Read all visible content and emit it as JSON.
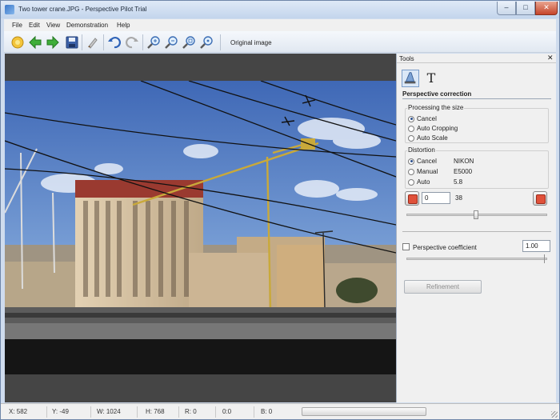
{
  "window": {
    "title": "Two tower crane.JPG - Perspective Pilot Trial",
    "minimize_glyph": "–",
    "maximize_glyph": "□",
    "close_glyph": "✕"
  },
  "menu": [
    "File",
    "Edit",
    "View",
    "Demonstration",
    "Help"
  ],
  "toolbar": {
    "icons": [
      "open-file-icon",
      "back-arrow-icon",
      "forward-arrow-icon",
      "save-icon",
      "brush-icon",
      "undo-icon",
      "redo-icon",
      "zoom-in-icon",
      "zoom-out-icon",
      "zoom-fit-icon",
      "zoom-actual-icon"
    ],
    "original_image_label": "Original image"
  },
  "tools_panel": {
    "title": "Tools",
    "close_glyph": "✕",
    "text_tab_glyph": "T",
    "section_title": "Perspective correction",
    "processing": {
      "label": "Processing the size",
      "options": [
        {
          "label": "Cancel",
          "selected": true
        },
        {
          "label": "Auto Cropping",
          "selected": false
        },
        {
          "label": "Auto Scale",
          "selected": false
        }
      ]
    },
    "distortion": {
      "label": "Distortion",
      "options": [
        {
          "label": "Cancel",
          "selected": true
        },
        {
          "label": "Manual",
          "selected": false
        },
        {
          "label": "Auto",
          "selected": false
        }
      ],
      "info": [
        "NIKON",
        "E5000",
        "5.8"
      ]
    },
    "distortion_value": "0",
    "distortion_max": "38",
    "perspective_coefficient_label": "Perspective coefficient",
    "perspective_coefficient_value": "1.00",
    "perspective_coefficient_checked": false,
    "refinement_label": "Refinement"
  },
  "status": {
    "x": "X: 582",
    "y": "Y: -49",
    "w": "W: 1024",
    "h": "H: 768",
    "r": "R: 0",
    "zero": "0:0",
    "b": "B: 0"
  },
  "colors": {
    "accent_close": "#c5442a",
    "sky_top": "#3f68b6",
    "sky_bottom": "#a9c4e4",
    "building": "#d9c7a9",
    "roof": "#9a3a30",
    "crane": "#c9a93a"
  }
}
